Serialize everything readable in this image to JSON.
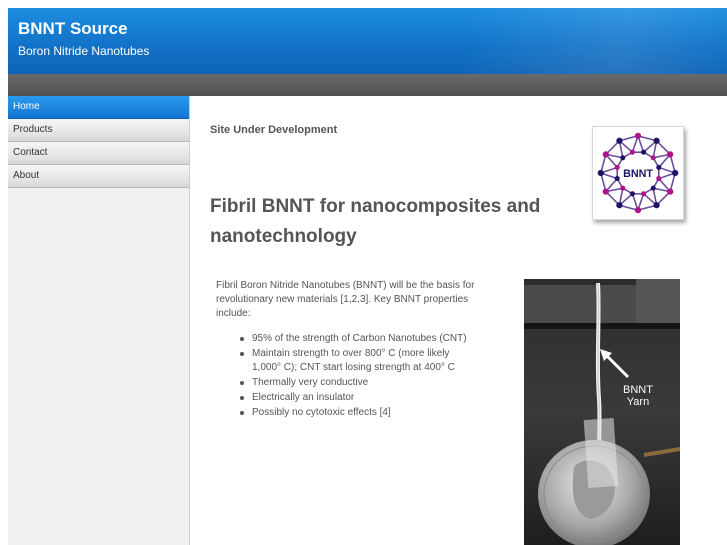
{
  "site": {
    "title": "BNNT Source",
    "subtitle": "Boron Nitride Nanotubes"
  },
  "nav": {
    "items": [
      {
        "label": "Home",
        "active": true
      },
      {
        "label": "Products",
        "active": false
      },
      {
        "label": "Contact",
        "active": false
      },
      {
        "label": "About",
        "active": false
      }
    ]
  },
  "main": {
    "status": "Site Under Development",
    "logo_text": "BNNT",
    "heading": "Fibril BNNT for nanocomposites and nanotechnology",
    "intro": "Fibril Boron Nitride Nanotubes (BNNT) will be the basis for revolutionary new materials [1,2,3]. Key BNNT properties include:",
    "properties": [
      "95% of the strength of Carbon Nanotubes (CNT)",
      "Maintain strength to over 800° C (more likely 1,000° C); CNT start losing strength at 400° C",
      "Thermally very conductive",
      "Electrically an insulator",
      "Possibly no cytotoxic effects [4]"
    ],
    "photo_label": "BNNT Yarn"
  },
  "colors": {
    "header_blue": "#1273c9",
    "nav_active_blue": "#1376d0",
    "dark_bar": "#555555",
    "logo_purple": "#6a4c9c",
    "logo_magenta": "#b0128c",
    "logo_navy": "#1b1464"
  }
}
